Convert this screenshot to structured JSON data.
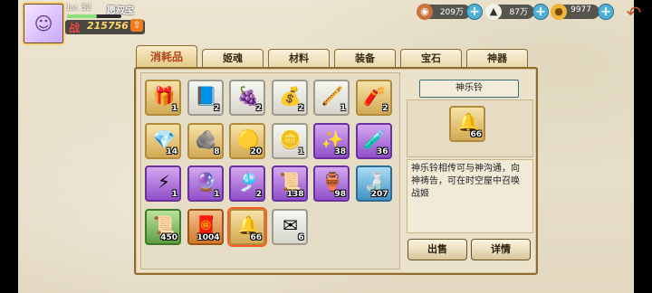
{
  "player": {
    "level": "Lv. 32",
    "name": "愿叔宝",
    "power_label": "战",
    "power_value": "215756",
    "exp_fraction": 0.55
  },
  "resources": [
    {
      "icon": "copper-coin-icon",
      "value": "209万"
    },
    {
      "icon": "rice-ball-icon",
      "value": "87万"
    },
    {
      "icon": "gold-ingot-icon",
      "value": "9977"
    }
  ],
  "tabs": [
    {
      "label": "消耗品",
      "active": true
    },
    {
      "label": "姬魂",
      "active": false
    },
    {
      "label": "材料",
      "active": false
    },
    {
      "label": "装备",
      "active": false
    },
    {
      "label": "宝石",
      "active": false
    },
    {
      "label": "神器",
      "active": false
    }
  ],
  "inventory": [
    {
      "icon": "gift-box-icon",
      "glyph": "🎁",
      "quality": "gold",
      "count": "1"
    },
    {
      "icon": "book-icon",
      "glyph": "📘",
      "quality": "white",
      "count": "2"
    },
    {
      "icon": "grape-bunch-icon",
      "glyph": "🍇",
      "quality": "white",
      "count": "2"
    },
    {
      "icon": "sack-icon",
      "glyph": "💰",
      "quality": "white",
      "count": "2"
    },
    {
      "icon": "pipe-icon",
      "glyph": "🪈",
      "quality": "white",
      "count": "1"
    },
    {
      "icon": "firecracker-icon",
      "glyph": "🧨",
      "quality": "gold",
      "count": "2"
    },
    {
      "icon": "treasure-pile-icon",
      "glyph": "💎",
      "quality": "gold",
      "count": "14"
    },
    {
      "icon": "ore-icon",
      "glyph": "🪨",
      "quality": "gold",
      "count": "8"
    },
    {
      "icon": "gold-orb-icon",
      "glyph": "🟡",
      "quality": "gold",
      "count": "20"
    },
    {
      "icon": "silver-coins-icon",
      "glyph": "🪙",
      "quality": "white",
      "count": "1"
    },
    {
      "icon": "magic-star-icon",
      "glyph": "✨",
      "quality": "purple",
      "count": "38"
    },
    {
      "icon": "potion-icon",
      "glyph": "🧪",
      "quality": "purple",
      "count": "36"
    },
    {
      "icon": "lightning-book-icon",
      "glyph": "⚡",
      "quality": "purple",
      "count": "1"
    },
    {
      "icon": "crystal-icon",
      "glyph": "🔮",
      "quality": "purple",
      "count": "1"
    },
    {
      "icon": "charm-icon",
      "glyph": "🎐",
      "quality": "purple",
      "count": "2"
    },
    {
      "icon": "scroll-icon",
      "glyph": "📜",
      "quality": "purple",
      "count": "138"
    },
    {
      "icon": "vase-icon",
      "glyph": "🏺",
      "quality": "purple",
      "count": "98"
    },
    {
      "icon": "bottle-icon",
      "glyph": "🍶",
      "quality": "blue",
      "count": "207"
    },
    {
      "icon": "green-scroll-icon",
      "glyph": "📜",
      "quality": "green",
      "count": "450"
    },
    {
      "icon": "red-banner-icon",
      "glyph": "🧧",
      "quality": "orange",
      "count": "1004"
    },
    {
      "icon": "bell-icon",
      "glyph": "🔔",
      "quality": "gold",
      "count": "66",
      "selected": true
    },
    {
      "icon": "letter-icon",
      "glyph": "✉",
      "quality": "white",
      "count": "6"
    }
  ],
  "detail": {
    "name": "神乐铃",
    "count": "66",
    "description": "神乐铃相传可与神沟通，向神祷告，可在时空屋中召唤战姬",
    "sell_label": "出售",
    "details_label": "详情"
  }
}
